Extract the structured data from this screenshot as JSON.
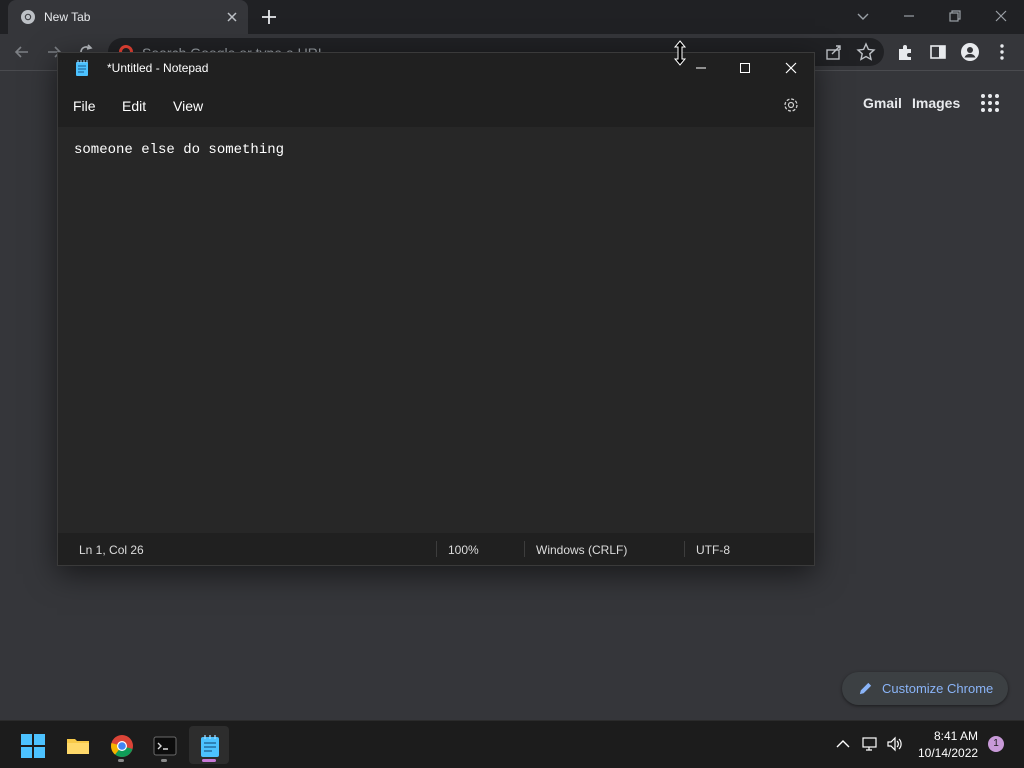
{
  "chrome": {
    "tab_title": "New Tab",
    "omnibox_placeholder": "Search Google or type a URL",
    "links": {
      "gmail": "Gmail",
      "images": "Images"
    },
    "customize_label": "Customize Chrome",
    "icons": [
      "chrome-favicon",
      "close-icon",
      "plus-icon",
      "chevron-down-icon",
      "minimize-icon",
      "restore-icon",
      "back-arrow-icon",
      "forward-arrow-icon",
      "reload-icon",
      "share-icon",
      "star-icon",
      "puzzle-icon",
      "side-panel-icon",
      "profile-icon",
      "kebab-menu-icon",
      "apps-grid-icon",
      "pencil-icon"
    ],
    "colors": {
      "background": "#35363a",
      "tabstrip": "#202124",
      "link_blue": "#8ab4f8"
    }
  },
  "notepad": {
    "title": "*Untitled - Notepad",
    "menu": {
      "file": "File",
      "edit": "Edit",
      "view": "View"
    },
    "content": "someone else do something",
    "status": {
      "position": "Ln 1, Col 26",
      "zoom": "100%",
      "line_ending": "Windows (CRLF)",
      "encoding": "UTF-8"
    },
    "icons": [
      "notepad-icon",
      "minimize-icon",
      "maximize-icon",
      "close-icon",
      "settings-gear-icon"
    ]
  },
  "taskbar": {
    "apps": [
      "Start",
      "File Explorer",
      "Google Chrome",
      "Terminal",
      "Notepad"
    ],
    "active_app": "Notepad",
    "time": "8:41 AM",
    "date": "10/14/2022",
    "notification_count": "1"
  }
}
